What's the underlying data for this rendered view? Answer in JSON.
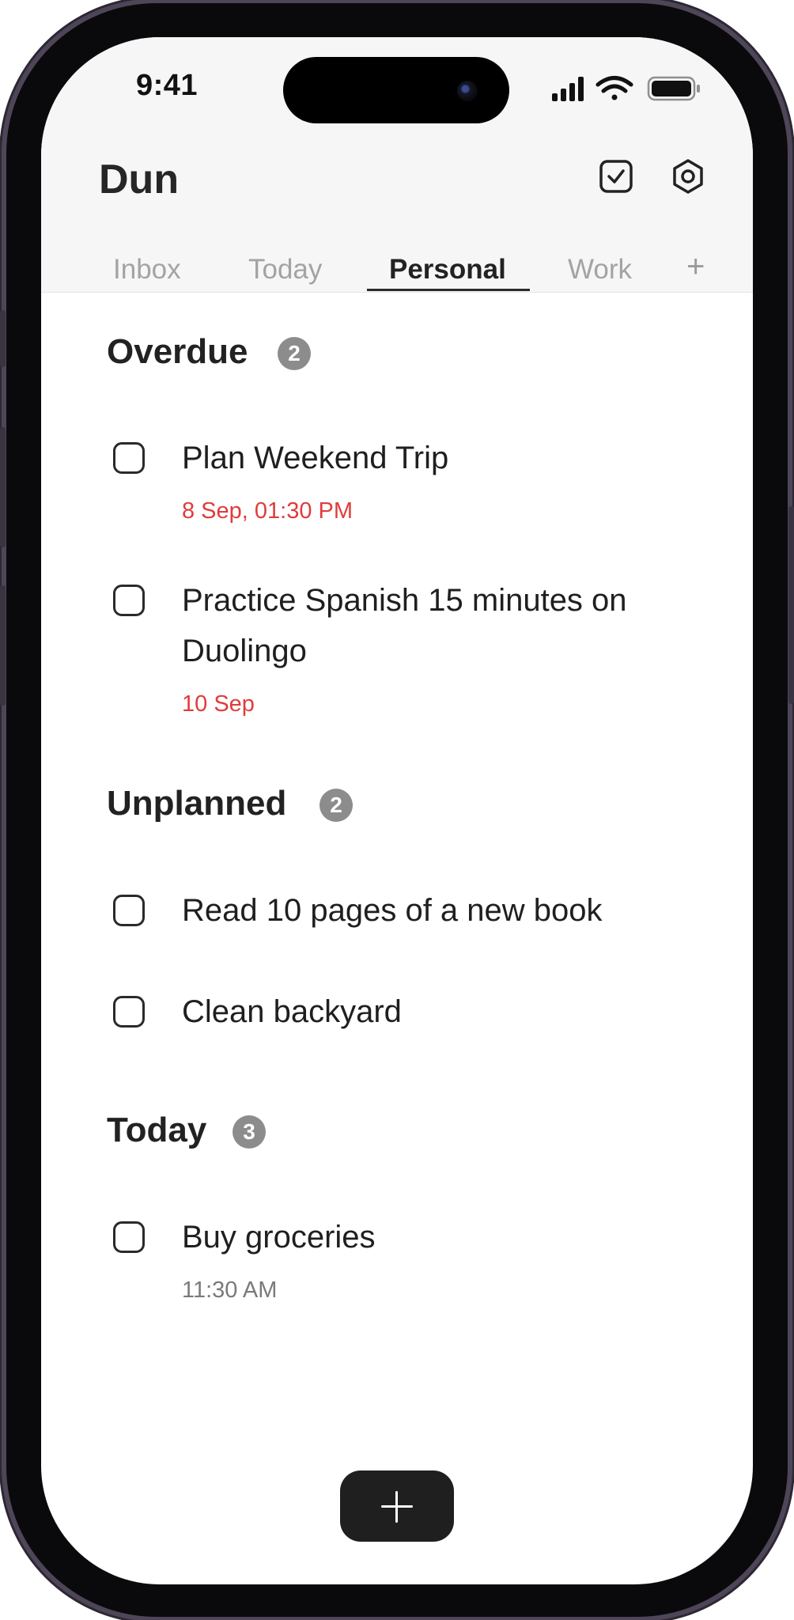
{
  "status_bar": {
    "time": "9:41"
  },
  "app": {
    "title": "Dun"
  },
  "tabs": [
    {
      "label": "Inbox",
      "active": false
    },
    {
      "label": "Today",
      "active": false
    },
    {
      "label": "Personal",
      "active": true
    },
    {
      "label": "Work",
      "active": false
    }
  ],
  "tab_add_label": "+",
  "sections": [
    {
      "title": "Overdue",
      "count": "2",
      "tasks": [
        {
          "title": "Plan Weekend Trip",
          "date": "8 Sep, 01:30 PM"
        },
        {
          "title": "Practice Spanish 15 minutes on Duolingo",
          "date": "10 Sep"
        }
      ]
    },
    {
      "title": "Unplanned",
      "count": "2",
      "tasks": [
        {
          "title": "Read 10 pages of a new book"
        },
        {
          "title": "Clean backyard"
        }
      ]
    },
    {
      "title": "Today",
      "count": "3",
      "tasks": [
        {
          "title": "Buy groceries",
          "date": "11:30 AM"
        }
      ]
    }
  ],
  "icons": {
    "header": [
      "checkbox-checked-icon",
      "gear-icon"
    ],
    "status": [
      "signal-icon",
      "wifi-icon",
      "battery-icon"
    ],
    "fab": "plus-icon"
  },
  "colors": {
    "overdue_date": "#e03c3c",
    "neutral_date": "#7a7a7a",
    "badge": "#8c8c8c",
    "fab": "#1f1f1f",
    "frame_accent": "#4e4658"
  }
}
